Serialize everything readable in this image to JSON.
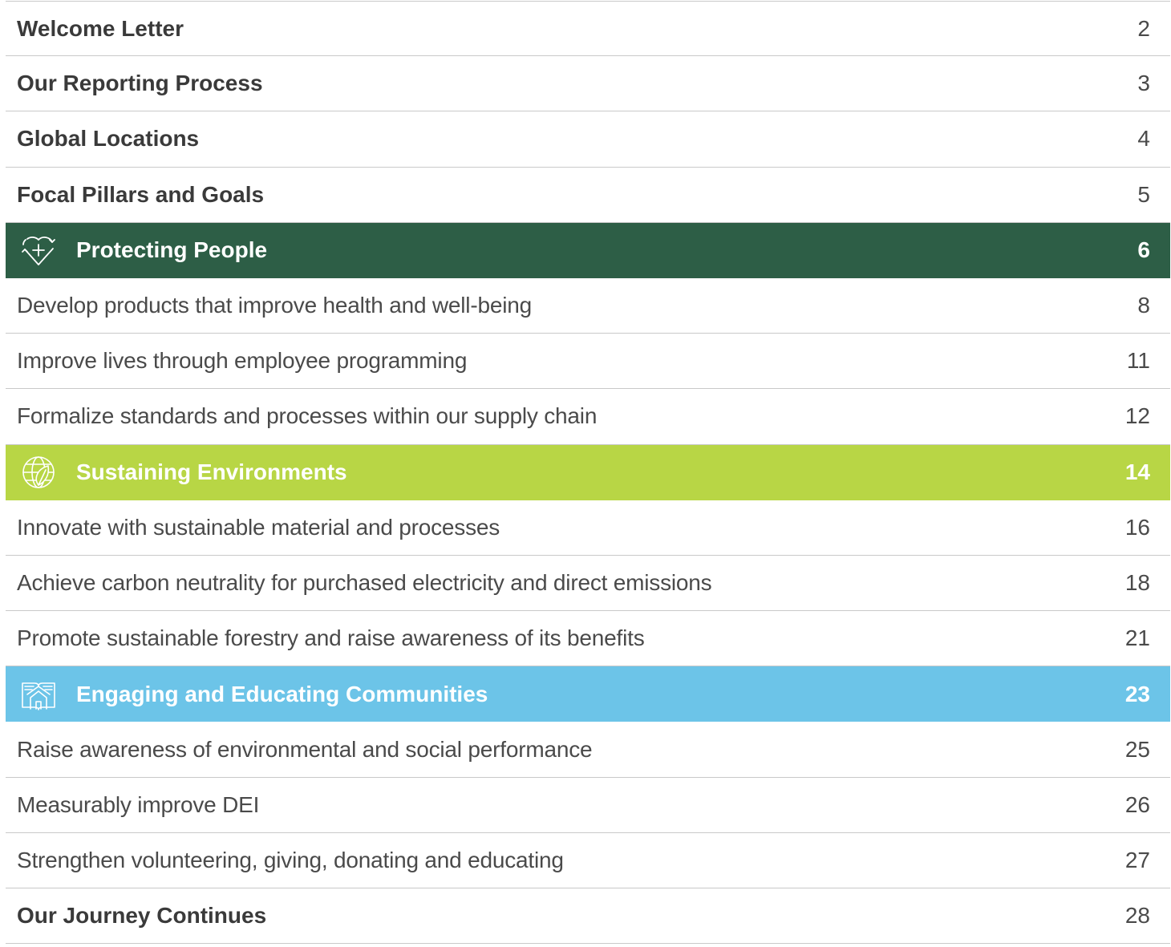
{
  "toc": {
    "entries": [
      {
        "type": "bold",
        "label": "Welcome Letter",
        "page": "2"
      },
      {
        "type": "bold",
        "label": "Our Reporting Process",
        "page": "3"
      },
      {
        "type": "bold",
        "label": "Global Locations",
        "page": "4"
      },
      {
        "type": "bold",
        "label": "Focal Pillars and Goals",
        "page": "5"
      },
      {
        "type": "section",
        "label": "Protecting People",
        "page": "6",
        "icon": "heart-plus-icon",
        "color": "#2d5e46"
      },
      {
        "type": "light",
        "label": "Develop products that improve health and well-being",
        "page": "8"
      },
      {
        "type": "light",
        "label": "Improve lives through employee programming",
        "page": "11"
      },
      {
        "type": "light",
        "label": "Formalize standards and processes within our supply chain",
        "page": "12"
      },
      {
        "type": "section",
        "label": "Sustaining Environments",
        "page": "14",
        "icon": "globe-leaf-icon",
        "color": "#b8d645"
      },
      {
        "type": "light",
        "label": "Innovate with sustainable material and processes",
        "page": "16"
      },
      {
        "type": "light",
        "label": "Achieve carbon neutrality for purchased electricity and direct emissions",
        "page": "18"
      },
      {
        "type": "light",
        "label": "Promote sustainable forestry and raise awareness of its benefits",
        "page": "21"
      },
      {
        "type": "section",
        "label": "Engaging and Educating Communities",
        "page": "23",
        "icon": "house-book-icon",
        "color": "#6cc4e8"
      },
      {
        "type": "light",
        "label": "Raise awareness of environmental and social performance",
        "page": "25"
      },
      {
        "type": "light",
        "label": "Measurably improve DEI",
        "page": "26"
      },
      {
        "type": "light",
        "label": "Strengthen volunteering, giving, donating and educating",
        "page": "27"
      },
      {
        "type": "bold",
        "label": "Our Journey Continues",
        "page": "28"
      }
    ]
  }
}
